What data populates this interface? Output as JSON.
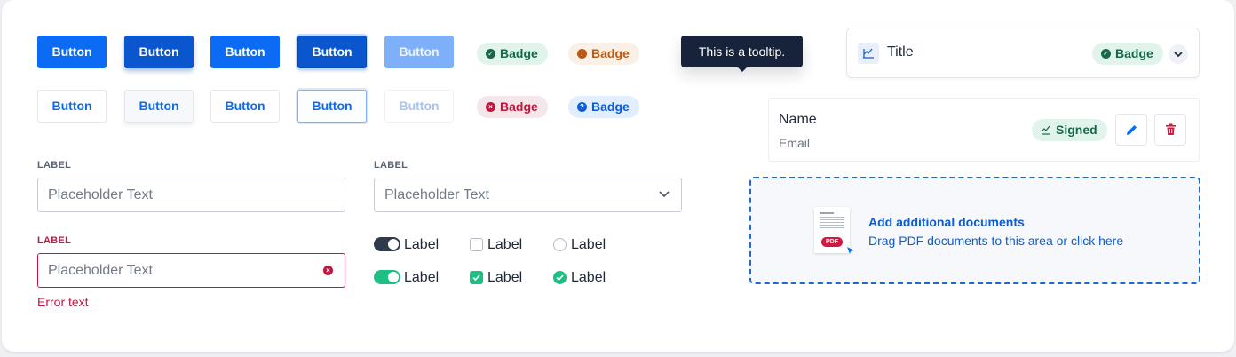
{
  "buttons": {
    "solid": [
      "Button",
      "Button",
      "Button",
      "Button",
      "Button"
    ],
    "outline": [
      "Button",
      "Button",
      "Button",
      "Button",
      "Button"
    ]
  },
  "badges": {
    "row1": [
      {
        "label": "Badge",
        "variant": "success",
        "icon": "check-circle-icon"
      },
      {
        "label": "Badge",
        "variant": "warning",
        "icon": "exclamation-circle-icon"
      }
    ],
    "row2": [
      {
        "label": "Badge",
        "variant": "danger",
        "icon": "x-circle-icon"
      },
      {
        "label": "Badge",
        "variant": "info",
        "icon": "question-circle-icon"
      }
    ]
  },
  "tooltip": "This is a tooltip.",
  "form": {
    "text_field": {
      "label": "LABEL",
      "placeholder": "Placeholder Text"
    },
    "select_field": {
      "label": "LABEL",
      "placeholder": "Placeholder Text"
    },
    "error_field": {
      "label": "LABEL",
      "placeholder": "Placeholder Text",
      "error": "Error text"
    }
  },
  "controls": {
    "toggle_off": "Label",
    "toggle_on": "Label",
    "checkbox_off": "Label",
    "checkbox_on": "Label",
    "radio_off": "Label",
    "radio_on": "Label"
  },
  "accordion": {
    "title": "Title",
    "badge": "Badge"
  },
  "signer": {
    "name": "Name",
    "email": "Email",
    "status": "Signed"
  },
  "dropzone": {
    "title": "Add additional documents",
    "subtitle": "Drag PDF documents to this area or click here",
    "file_tag": "PDF"
  },
  "colors": {
    "primary": "#0b6bf4",
    "success": "#17684a",
    "warning": "#b85a12",
    "danger": "#c1173f",
    "toggle_on": "#1fbf84",
    "tooltip_bg": "#16233a"
  }
}
